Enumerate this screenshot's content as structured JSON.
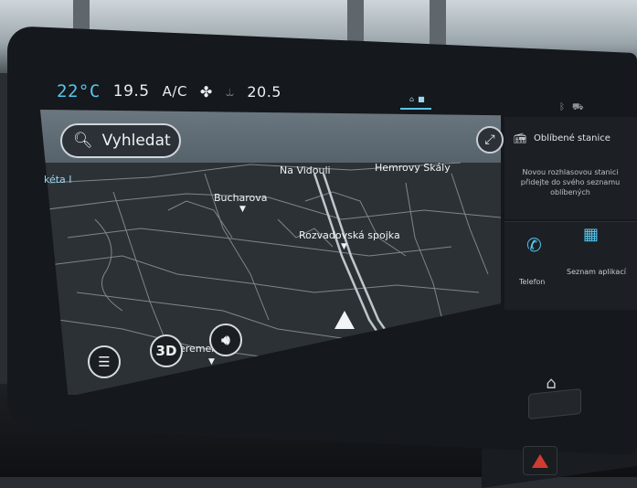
{
  "climate": {
    "temp_left": "22°C",
    "temp_center": "19.5",
    "ac_label": "A/C",
    "fan_icon": "fan-icon",
    "seat_icon": "seat-heat-icon",
    "temp_right": "20.5"
  },
  "status": {
    "bluetooth_icon": "bluetooth-icon",
    "car_icon": "car-icon"
  },
  "navigation": {
    "search_label": "Vyhledat",
    "map_labels": {
      "left_edge": "kéta I",
      "vidouli": "Na Vidouli",
      "hemrovy": "Hemrovy Skály",
      "bucharova": "Bucharova",
      "rozvadovska": "Rozvadovská spojka",
      "bottom": "eremenk a"
    },
    "view_mode": "3D",
    "colors": {
      "accent": "#56c6ef",
      "map_bg": "#2c3136",
      "road": "#8c969c"
    }
  },
  "widgets": {
    "favorites_title": "Oblíbené stanice",
    "favorites_message": "Novou rozhlasovou stanici přidejte do svého seznamu oblíbených",
    "phone_label": "Telefon",
    "apps_label": "Seznam aplikací"
  }
}
